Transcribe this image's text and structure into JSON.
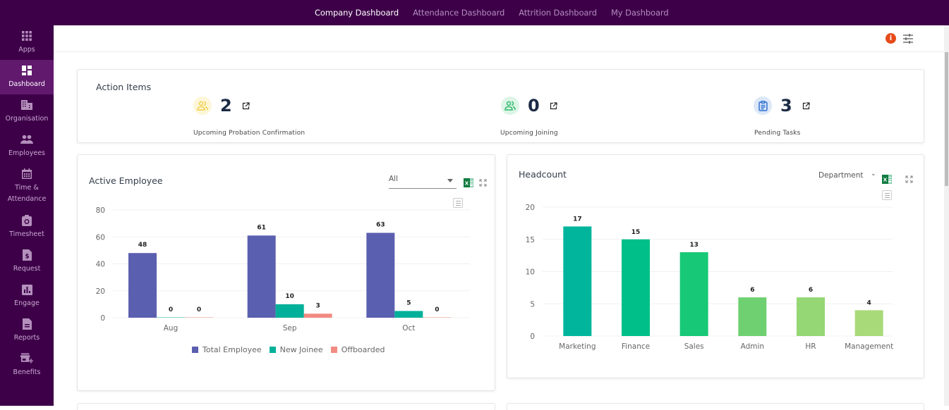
{
  "topnav": {
    "tabs": [
      {
        "label": "Company Dashboard",
        "active": true
      },
      {
        "label": "Attendance Dashboard",
        "active": false
      },
      {
        "label": "Attrition Dashboard",
        "active": false
      },
      {
        "label": "My Dashboard",
        "active": false
      }
    ]
  },
  "sidebar": {
    "items": [
      {
        "label": "Apps",
        "icon": "apps-grid-icon",
        "active": false
      },
      {
        "label": "Dashboard",
        "icon": "dashboard-icon",
        "active": true
      },
      {
        "label": "Organisation",
        "icon": "building-icon",
        "active": false
      },
      {
        "label": "Employees",
        "icon": "people-icon",
        "active": false
      },
      {
        "label": "Time & Attendance",
        "icon": "calendar-icon",
        "active": false
      },
      {
        "label": "Timesheet",
        "icon": "timesheet-icon",
        "active": false
      },
      {
        "label": "Request",
        "icon": "request-dollar-icon",
        "active": false
      },
      {
        "label": "Engage",
        "icon": "bar-chart-icon",
        "active": false
      },
      {
        "label": "Reports",
        "icon": "report-document-icon",
        "active": false
      },
      {
        "label": "Benefits",
        "icon": "benefits-store-icon",
        "active": false
      }
    ]
  },
  "header": {
    "info_icon": "i"
  },
  "action_items": {
    "title": "Action Items",
    "items": [
      {
        "count": "2",
        "label": "Upcoming Probation Confirmation",
        "icon": "users-icon",
        "icon_color": "#f2cf4a",
        "bg_color": "#fdf6d8"
      },
      {
        "count": "0",
        "label": "Upcoming Joining",
        "icon": "users-icon",
        "icon_color": "#2eb86a",
        "bg_color": "#dcf5e6"
      },
      {
        "count": "3",
        "label": "Pending Tasks",
        "icon": "clipboard-icon",
        "icon_color": "#2f6fd1",
        "bg_color": "#dce8f8"
      }
    ]
  },
  "active_employee": {
    "title": "Active Employee",
    "filter_value": "All"
  },
  "headcount": {
    "title": "Headcount",
    "group_by": "Department"
  },
  "colors": {
    "brand": "#3d0048",
    "sidebar_active": "#61196e",
    "total_employee": "#5b5fb0",
    "new_joinee": "#00b09a",
    "offboarded": "#f28b82"
  },
  "chart_data": [
    {
      "type": "bar",
      "title": "Active Employee",
      "categories": [
        "Aug",
        "Sep",
        "Oct"
      ],
      "series": [
        {
          "name": "Total Employee",
          "values": [
            48,
            61,
            63
          ],
          "color": "#5b5fb0"
        },
        {
          "name": "New Joinee",
          "values": [
            0,
            10,
            5
          ],
          "color": "#00b09a"
        },
        {
          "name": "Offboarded",
          "values": [
            0,
            3,
            0
          ],
          "color": "#f28b82"
        }
      ],
      "yticks": [
        0,
        20,
        40,
        60,
        80
      ],
      "ylim": [
        0,
        80
      ],
      "xlabel": "",
      "ylabel": "",
      "grid": true,
      "legend": "bottom"
    },
    {
      "type": "bar",
      "title": "Headcount",
      "categories": [
        "Marketing",
        "Finance",
        "Sales",
        "Admin",
        "HR",
        "Management"
      ],
      "values": [
        17,
        15,
        13,
        6,
        6,
        4
      ],
      "colors": [
        "#00b59c",
        "#00bf88",
        "#17c877",
        "#6fd071",
        "#94d774",
        "#a8da79"
      ],
      "yticks": [
        0,
        5,
        10,
        15,
        20
      ],
      "ylim": [
        0,
        20
      ],
      "xlabel": "",
      "ylabel": "",
      "grid": true,
      "legend": "none"
    }
  ]
}
